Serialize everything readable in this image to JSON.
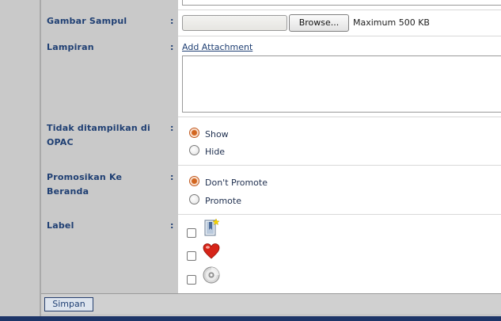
{
  "form": {
    "cover": {
      "label": "Gambar Sampul",
      "colon": ":",
      "browse_label": "Browse...",
      "hint": "Maximum 500 KB"
    },
    "attachment": {
      "label": "Lampiran",
      "colon": ":",
      "add_link": "Add Attachment"
    },
    "opac": {
      "label_line1": "Tidak ditampilkan di",
      "label_line2": "OPAC",
      "colon": ":",
      "options": [
        {
          "label": "Show",
          "selected": true
        },
        {
          "label": "Hide",
          "selected": false
        }
      ]
    },
    "promote": {
      "label_line1": "Promosikan Ke",
      "label_line2": "Beranda",
      "colon": ":",
      "options": [
        {
          "label": "Don't Promote",
          "selected": true
        },
        {
          "label": "Promote",
          "selected": false
        }
      ]
    },
    "labels": {
      "label": "Label",
      "colon": ":",
      "items": [
        {
          "icon": "new-book-icon",
          "checked": false
        },
        {
          "icon": "heart-icon",
          "checked": false
        },
        {
          "icon": "disc-icon",
          "checked": false
        }
      ]
    }
  },
  "footer": {
    "save_label": "Simpan"
  },
  "colors": {
    "label_text": "#1f3f73",
    "bottom_bar": "#1d3568",
    "radio_selected": "#d2651f"
  }
}
